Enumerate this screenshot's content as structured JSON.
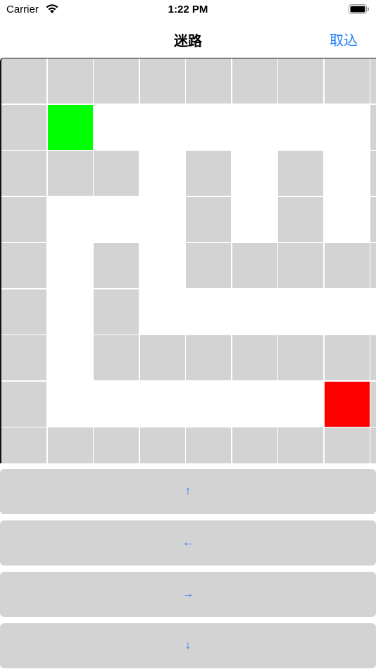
{
  "status": {
    "carrier": "Carrier",
    "time": "1:22 PM"
  },
  "nav": {
    "title": "迷路",
    "cancel_label": "取込"
  },
  "maze": {
    "colors": {
      "wall": "#d3d3d3",
      "path": "#ffffff",
      "start": "#00ff00",
      "end": "#ff0000"
    },
    "grid": [
      "WWWWWWWWW",
      "WSPPPPPPW",
      "WWWPWPWPW",
      "WPPPWPWPW",
      "WPWPWWWWW",
      "WPWPPPPPP",
      "WPWWWWWWW",
      "WPPPPPPEW",
      "WWWWWWWWW"
    ]
  },
  "controls": {
    "up": "↑",
    "left": "←",
    "right": "→",
    "down": "↓"
  }
}
